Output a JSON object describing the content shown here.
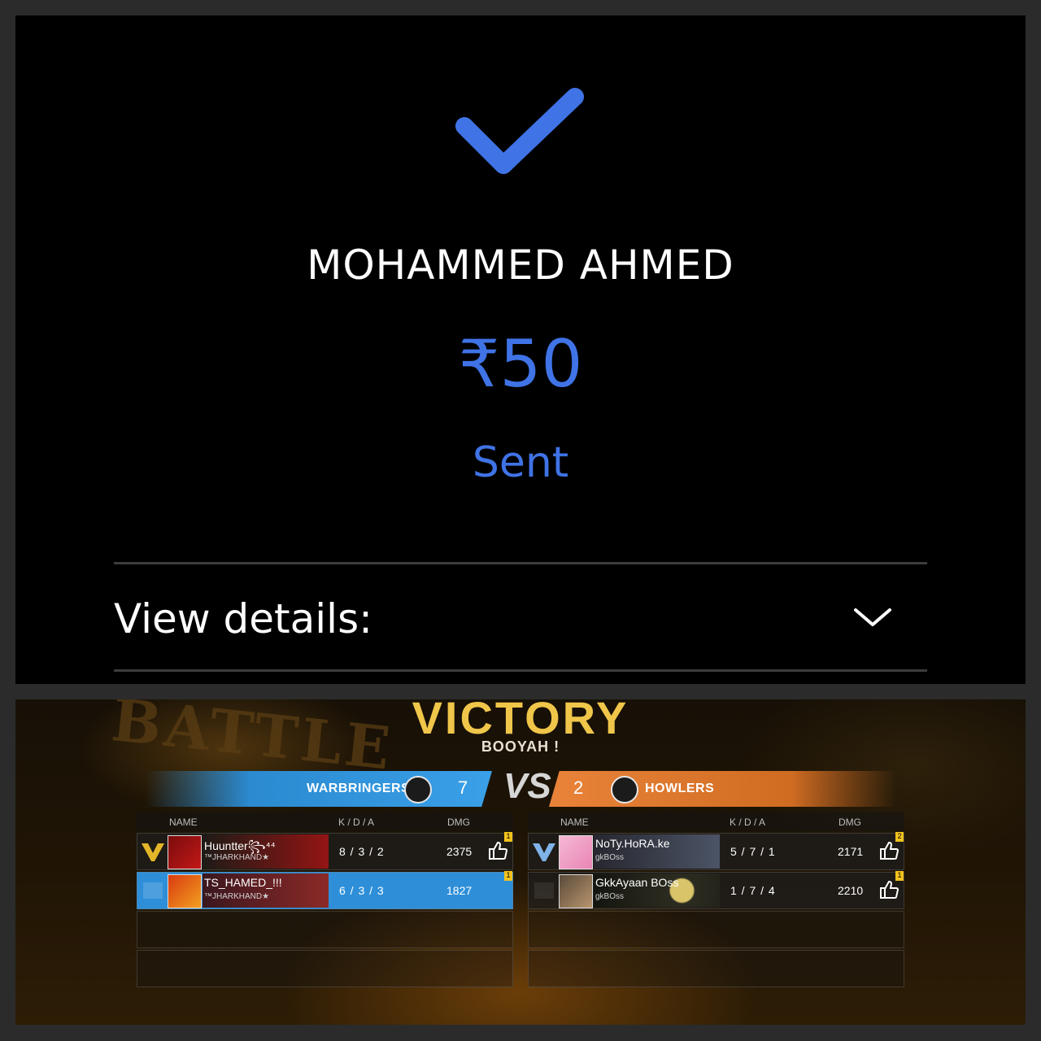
{
  "payment": {
    "payee": "MOHAMMED AHMED",
    "currency": "₹",
    "amount": "50",
    "status": "Sent",
    "details_label": "View details:",
    "accent_color": "#3f73e6"
  },
  "game": {
    "bg_title": "BATTLE",
    "title": "VICTORY",
    "subtitle": "BOOYAH !",
    "vs": "VS",
    "left_team": {
      "name": "WARBRINGERS",
      "score": "7",
      "color": "#2b8ad0"
    },
    "right_team": {
      "name": "HOWLERS",
      "score": "2",
      "color": "#e9833a"
    },
    "headers": {
      "name": "NAME",
      "kda": "K / D / A",
      "dmg": "DMG"
    },
    "left_players": [
      {
        "name": "Huuntter꧂⁴⁴",
        "tag": "™JHARKHAND★",
        "kda": "8 / 3 / 2",
        "dmg": "2375",
        "badge": "1",
        "rank_badge": "2"
      },
      {
        "name": "TS_HAMED_!!!",
        "tag": "™JHARKHAND★",
        "kda": "6 / 3 / 3",
        "dmg": "1827",
        "badge": "1",
        "rank_badge": "1"
      }
    ],
    "right_players": [
      {
        "name": "NoTy.HoRA.ke",
        "tag": "gkBOss",
        "kda": "5 / 7 / 1",
        "dmg": "2171",
        "badge": "2"
      },
      {
        "name": "GkkAyaan BOss",
        "tag": "gkBOss",
        "kda": "1 / 7 / 4",
        "dmg": "2210",
        "badge": "1"
      }
    ]
  }
}
